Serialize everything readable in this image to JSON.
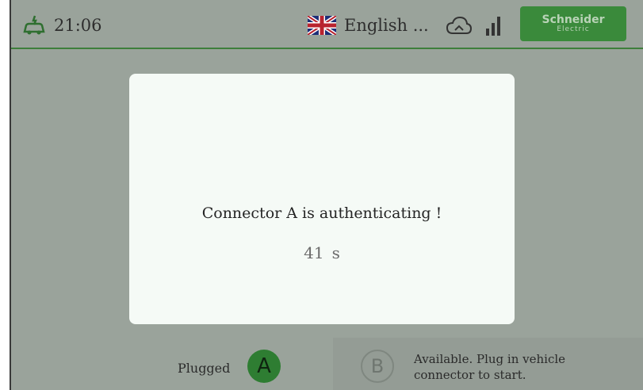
{
  "header": {
    "time": "21:06",
    "language": "English ...",
    "brand_line1": "Schneider",
    "brand_line2": "Electric",
    "icons": [
      "car-charging-icon",
      "uk-flag-icon",
      "cloud-icon",
      "signal-bars-icon"
    ]
  },
  "modal": {
    "message": "Connector A is authenticating !",
    "countdown_value": "41",
    "countdown_unit": "s"
  },
  "connectors": {
    "a_status": "Plugged",
    "a_label": "A",
    "b_label": "B",
    "b_status_line1": "Available. Plug in vehicle",
    "b_status_line2": "connector to start."
  },
  "colors": {
    "accent": "#3a8a3b",
    "overlay": "#9aa39b",
    "modal_bg": "#f5faf6"
  }
}
